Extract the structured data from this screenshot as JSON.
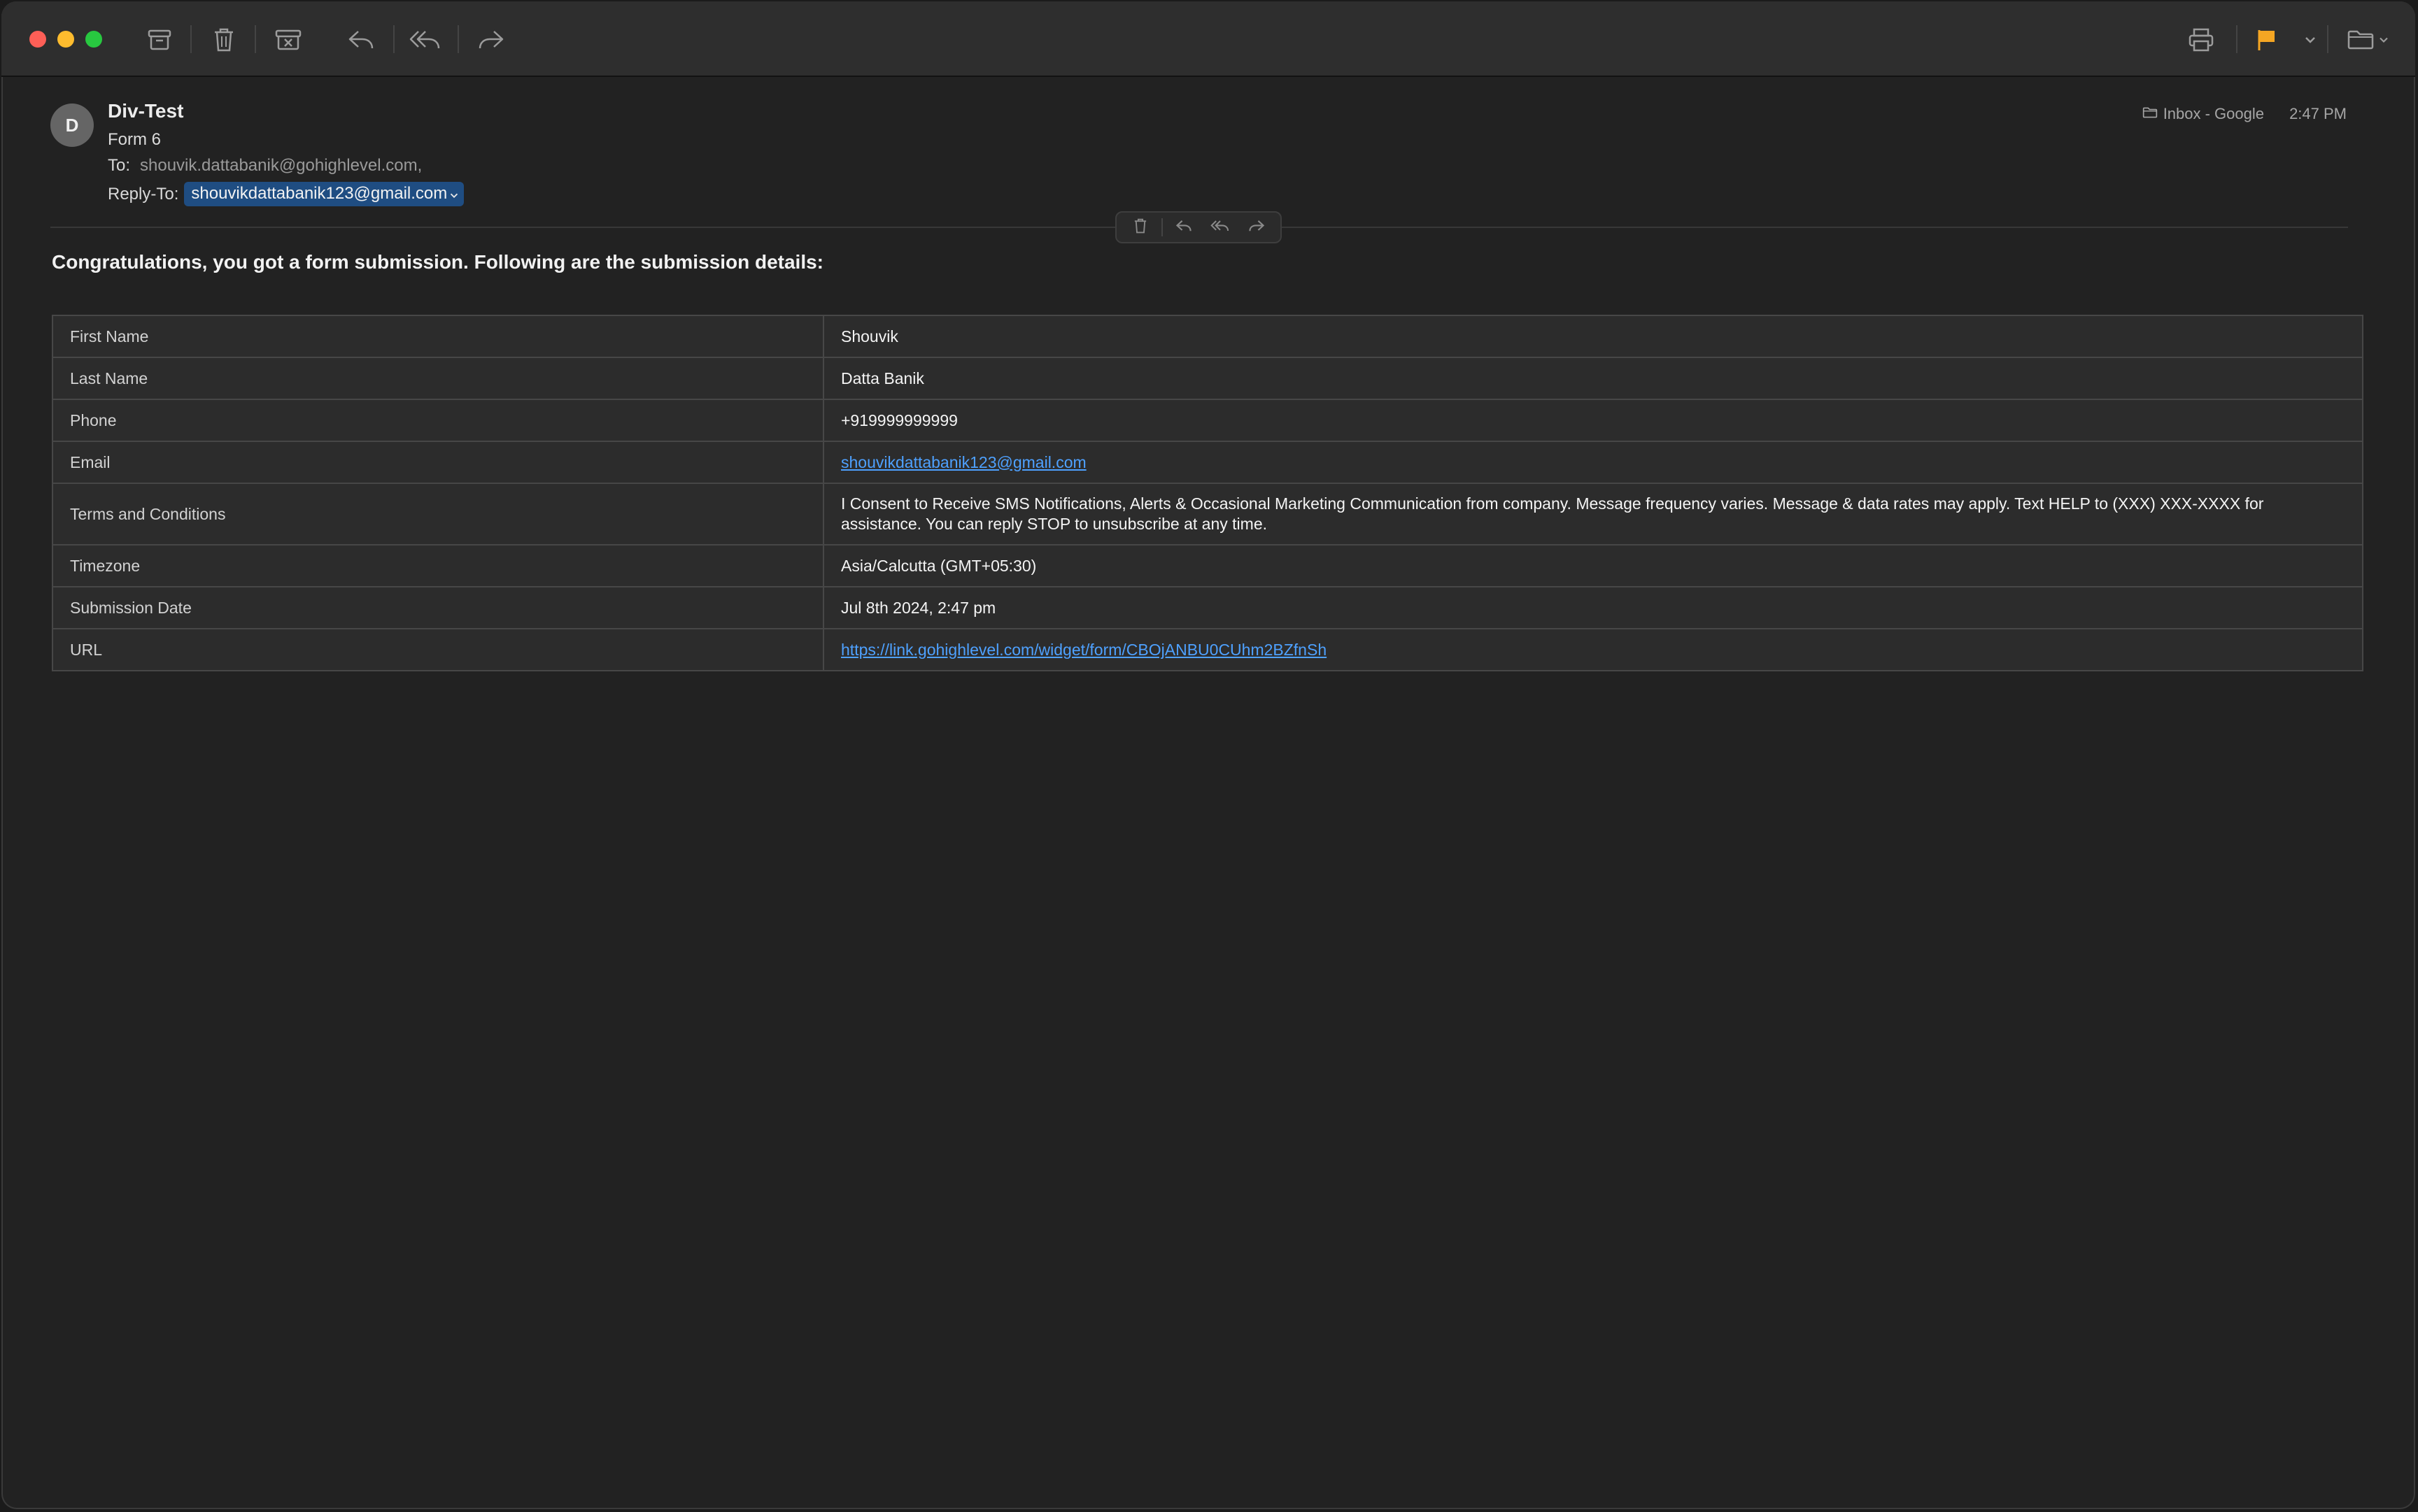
{
  "toolbar": {
    "icons": [
      "archive-icon",
      "trash-icon",
      "junk-icon",
      "reply-icon",
      "reply-all-icon",
      "forward-icon",
      "print-icon",
      "flag-icon",
      "chevron-down-icon",
      "folder-icon"
    ],
    "flag_color": "#f5a623"
  },
  "message": {
    "avatar_initial": "D",
    "sender": "Div-Test",
    "subject": "Form 6",
    "to_label": "To:",
    "to_value": "shouvik.dattabanik@gohighlevel.com,",
    "reply_to_label": "Reply-To:",
    "reply_to_value": "shouvikdattabanik123@gmail.com",
    "mailbox": "Inbox - Google",
    "time": "2:47 PM"
  },
  "body": {
    "heading": "Congratulations, you got a form submission. Following are the submission details:",
    "rows": [
      {
        "label": "First Name",
        "value": "Shouvik"
      },
      {
        "label": "Last Name",
        "value": "Datta Banik"
      },
      {
        "label": "Phone",
        "value": "+919999999999"
      },
      {
        "label": "Email",
        "value": "shouvikdattabanik123@gmail.com"
      },
      {
        "label": "Terms and Conditions",
        "value": "I Consent to Receive SMS Notifications, Alerts & Occasional Marketing Communication from company. Message frequency varies. Message & data rates may apply. Text HELP to (XXX) XXX-XXXX for assistance. You can reply STOP to unsubscribe at any time."
      },
      {
        "label": "Timezone",
        "value": "Asia/Calcutta (GMT+05:30)"
      },
      {
        "label": "Submission Date",
        "value": "Jul 8th 2024, 2:47 pm"
      },
      {
        "label": "URL",
        "value": "https://link.gohighlevel.com/widget/form/CBOjANBU0CUhm2BZfnSh"
      }
    ]
  },
  "colors": {
    "link": "#4ea1ff",
    "chip_bg": "#1f4d82",
    "window_bg": "#222222",
    "toolbar_bg": "#2e2e2e"
  }
}
